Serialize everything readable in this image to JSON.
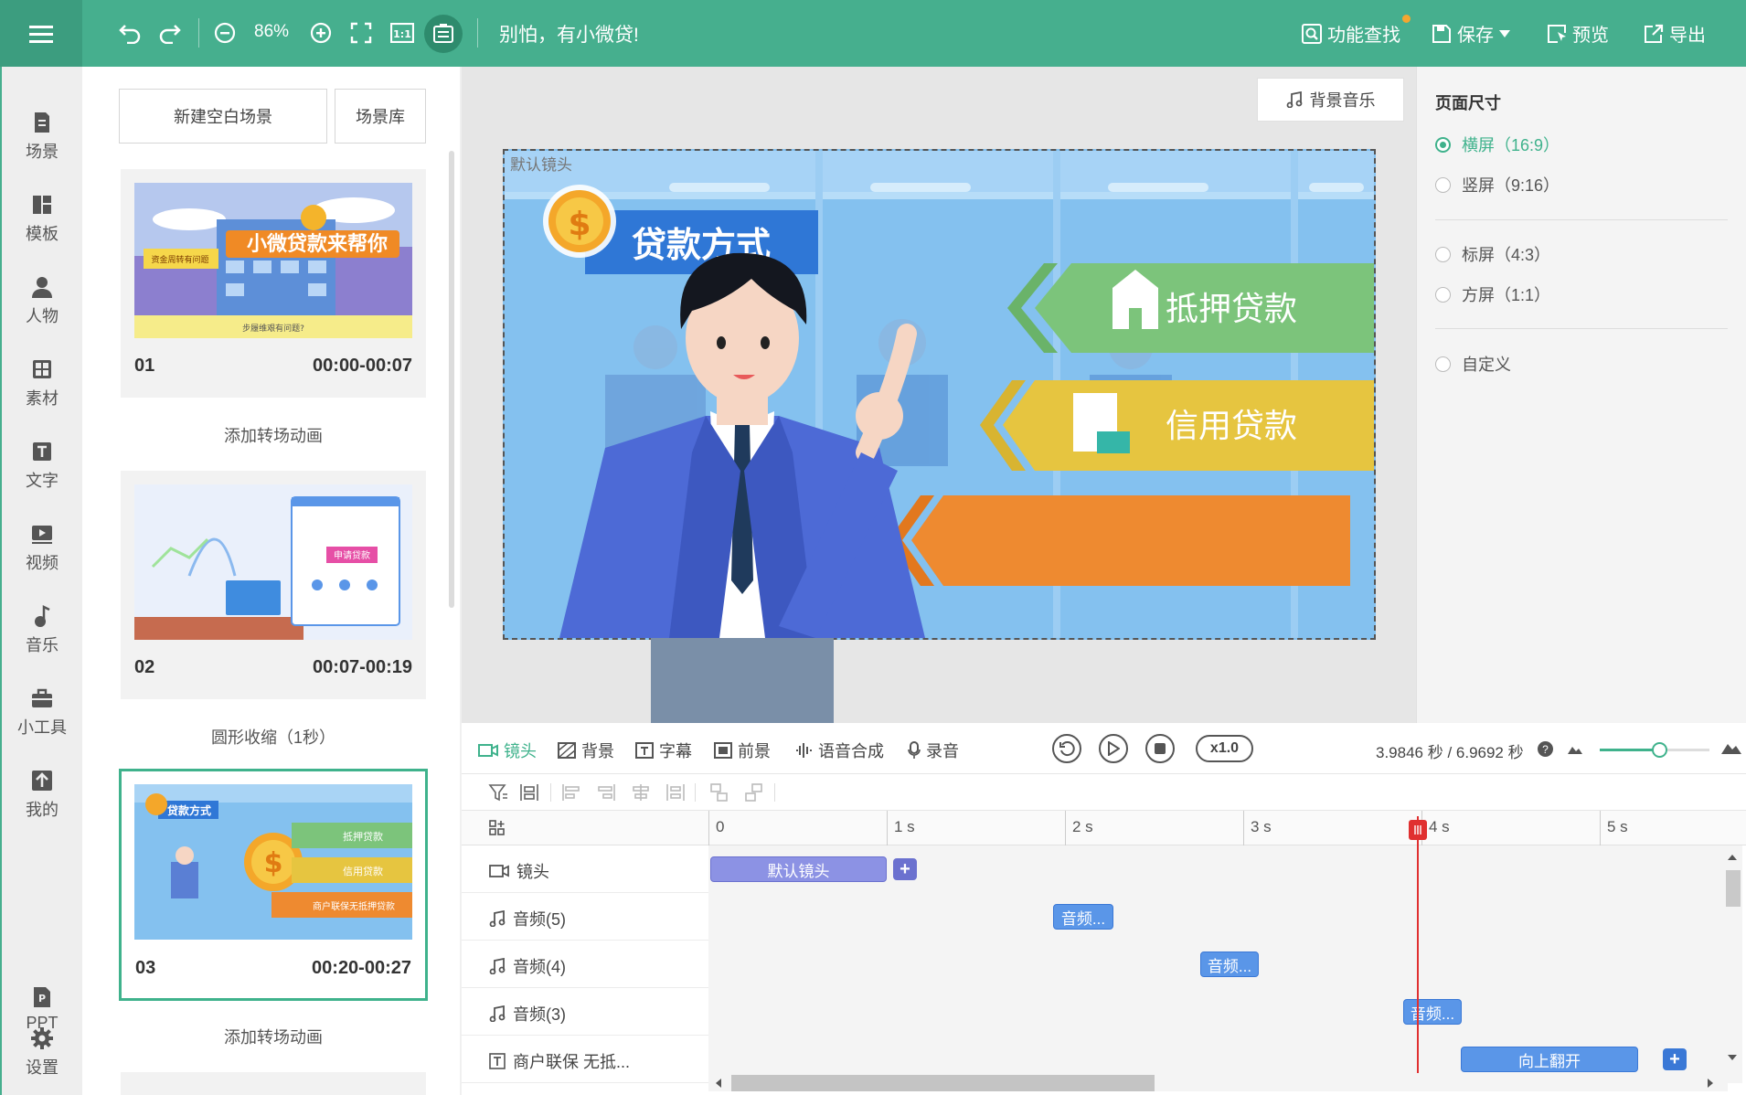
{
  "toolbar": {
    "zoom": "86%",
    "slogan": "别怕，有小微贷!",
    "feature_search": "功能查找",
    "save": "保存",
    "preview": "预览",
    "export": "导出"
  },
  "nav": [
    {
      "label": "场景",
      "icon": "scene-icon"
    },
    {
      "label": "模板",
      "icon": "template-icon"
    },
    {
      "label": "人物",
      "icon": "person-icon"
    },
    {
      "label": "素材",
      "icon": "material-icon"
    },
    {
      "label": "文字",
      "icon": "text-icon"
    },
    {
      "label": "视频",
      "icon": "video-icon"
    },
    {
      "label": "音乐",
      "icon": "music-icon"
    },
    {
      "label": "小工具",
      "icon": "toolbox-icon"
    },
    {
      "label": "我的",
      "icon": "upload-icon"
    },
    {
      "label": "PPT",
      "icon": "ppt-icon"
    },
    {
      "label": "设置",
      "icon": "gear-icon"
    }
  ],
  "scene_panel": {
    "new_blank": "新建空白场景",
    "library": "场景库",
    "scenes": [
      {
        "num": "01",
        "time": "00:00-00:07",
        "thumb_title": "小微贷款来帮你",
        "thumb_tag": "资金周转有问题",
        "thumb_sub": "步履维艰有问题?"
      },
      {
        "num": "02",
        "time": "00:07-00:19",
        "thumb_title": "申请贷款"
      },
      {
        "num": "03",
        "time": "00:20-00:27",
        "thumb_title": "贷款方式",
        "thumb_items": [
          "抵押贷款",
          "信用贷款",
          "商户联保无抵押贷款"
        ]
      }
    ],
    "transitions": [
      "添加转场动画",
      "圆形收缩（1秒）",
      "添加转场动画"
    ]
  },
  "canvas": {
    "bgm": "背景音乐",
    "camera_label": "默认镜头",
    "stage_title": "贷款方式",
    "option_1": "抵押贷款",
    "option_2": "信用贷款"
  },
  "page_size": {
    "title": "页面尺寸",
    "options": [
      "横屏（16:9）",
      "竖屏（9:16）",
      "标屏（4:3）",
      "方屏（1:1）",
      "自定义"
    ],
    "selected": "横屏（16:9）"
  },
  "timeline": {
    "tabs": [
      "镜头",
      "背景",
      "字幕",
      "前景",
      "语音合成",
      "录音"
    ],
    "speed": "x1.0",
    "time": "3.9846 秒 / 6.9692 秒",
    "zoom_value": 0.54,
    "ruler": [
      "0",
      "1 s",
      "2 s",
      "3 s",
      "4 s",
      "5 s"
    ],
    "tracks": [
      {
        "name": "镜头",
        "clip": "默认镜头"
      },
      {
        "name": "音频(5)",
        "clip": "音频..."
      },
      {
        "name": "音频(4)",
        "clip": "音频..."
      },
      {
        "name": "音频(3)",
        "clip": "音频..."
      },
      {
        "name": "商户联保 无抵...",
        "clip": "向上翻开"
      }
    ]
  },
  "colors": {
    "brand": "#46af8e",
    "playhead": "#e03030",
    "clip": "#5a96e8",
    "camera_clip": "#8c92e4"
  }
}
